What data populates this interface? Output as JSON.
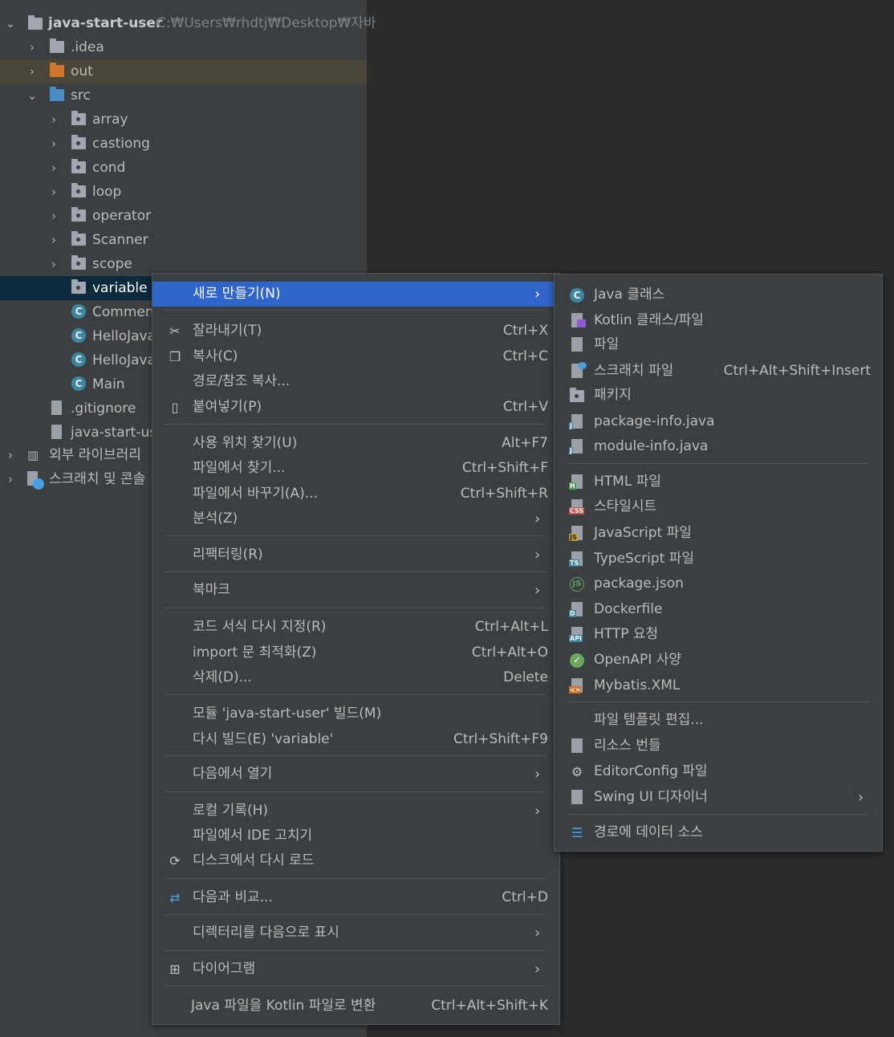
{
  "colors": {
    "panel": "#3c3f41",
    "editor": "#2b2b2b",
    "selection": "#0d293e",
    "menu_active": "#2f65ca",
    "text": "#bbbbbb"
  },
  "tree": {
    "project": {
      "name": "java-start-user",
      "path": "C:₩Users₩rhdtj₩Desktop₩자바"
    },
    "items": [
      {
        "label": ".idea",
        "icon": "folder-icon"
      },
      {
        "label": "out",
        "icon": "folder-orange-icon"
      },
      {
        "label": "src",
        "icon": "source-folder-icon"
      },
      {
        "label": "array",
        "icon": "package-icon"
      },
      {
        "label": "castiong",
        "icon": "package-icon"
      },
      {
        "label": "cond",
        "icon": "package-icon"
      },
      {
        "label": "loop",
        "icon": "package-icon"
      },
      {
        "label": "operator",
        "icon": "package-icon"
      },
      {
        "label": "Scanner",
        "icon": "package-icon"
      },
      {
        "label": "scope",
        "icon": "package-icon"
      },
      {
        "label": "variable",
        "icon": "package-icon"
      },
      {
        "label": "Commen",
        "icon": "java-class-icon"
      },
      {
        "label": "HelloJava",
        "icon": "java-class-icon"
      },
      {
        "label": "HelloJava",
        "icon": "java-class-icon"
      },
      {
        "label": "Main",
        "icon": "java-class-icon"
      },
      {
        "label": ".gitignore",
        "icon": "gitignore-icon"
      },
      {
        "label": "java-start-use",
        "icon": "iml-file-icon"
      },
      {
        "label": "외부 라이브러리",
        "icon": "library-icon"
      },
      {
        "label": "스크래치 및 콘솔",
        "icon": "scratch-icon"
      }
    ]
  },
  "menu": {
    "new": "새로 만들기(N)",
    "cut": "잘라내기(T)",
    "cut_sc": "Ctrl+X",
    "copy": "복사(C)",
    "copy_sc": "Ctrl+C",
    "copy_path": "경로/참조 복사...",
    "paste": "붙여넣기(P)",
    "paste_sc": "Ctrl+V",
    "find_usages": "사용 위치 찾기(U)",
    "find_usages_sc": "Alt+F7",
    "find_in_files": "파일에서 찾기...",
    "find_in_files_sc": "Ctrl+Shift+F",
    "replace_in_files": "파일에서 바꾸기(A)...",
    "replace_in_files_sc": "Ctrl+Shift+R",
    "analyze": "분석(Z)",
    "refactor": "리팩터링(R)",
    "bookmark": "북마크",
    "reformat": "코드 서식 다시 지정(R)",
    "reformat_sc": "Ctrl+Alt+L",
    "optimize_imports": "import 문 최적화(Z)",
    "optimize_imports_sc": "Ctrl+Alt+O",
    "delete": "삭제(D)...",
    "delete_sc": "Delete",
    "build_module": "모듈 'java-start-user' 빌드(M)",
    "rebuild": "다시 빌드(E) 'variable'",
    "rebuild_sc": "Ctrl+Shift+F9",
    "open_in": "다음에서 열기",
    "local_history": "로컬 기록(H)",
    "repair_ide": "파일에서 IDE 고치기",
    "reload": "디스크에서 다시 로드",
    "compare_with": "다음과 비교...",
    "compare_with_sc": "Ctrl+D",
    "mark_dir": "디렉터리를 다음으로 표시",
    "diagrams": "다이어그램",
    "convert_kotlin": "Java 파일을 Kotlin 파일로 변환",
    "convert_kotlin_sc": "Ctrl+Alt+Shift+K"
  },
  "submenu": {
    "java_class": "Java 클래스",
    "kotlin_class": "Kotlin 클래스/파일",
    "file": "파일",
    "scratch_file": "스크래치 파일",
    "scratch_file_sc": "Ctrl+Alt+Shift+Insert",
    "package": "패키지",
    "package_info": "package-info.java",
    "module_info": "module-info.java",
    "html_file": "HTML 파일",
    "stylesheet": "스타일시트",
    "javascript_file": "JavaScript 파일",
    "typescript_file": "TypeScript 파일",
    "package_json": "package.json",
    "dockerfile": "Dockerfile",
    "http_request": "HTTP 요청",
    "openapi": "OpenAPI 사양",
    "mybatis_xml": "Mybatis.XML",
    "edit_templates": "파일 템플릿 편집...",
    "resource_bundle": "리소스 번들",
    "editorconfig": "EditorConfig 파일",
    "swing_ui": "Swing UI 디자이너",
    "data_source": "경로에 데이터 소스"
  },
  "icons": {
    "tag_html": "H",
    "tag_css": "CSS",
    "tag_js": "JS",
    "tag_ts": "TS",
    "tag_docker": "D",
    "tag_api": "API",
    "tag_xml": "<>",
    "tag_j": "J",
    "tag_c": "C"
  }
}
